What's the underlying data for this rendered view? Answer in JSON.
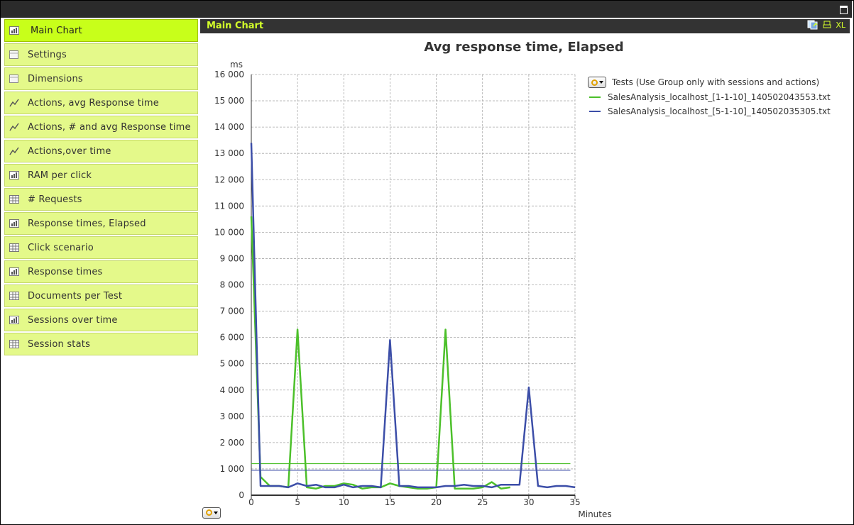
{
  "sidebar": {
    "items": [
      {
        "label": "Main Chart",
        "icon": "bar-chart-icon",
        "active": true
      },
      {
        "label": "Settings",
        "icon": "grid-icon",
        "active": false
      },
      {
        "label": "Dimensions",
        "icon": "grid-icon",
        "active": false
      },
      {
        "label": "Actions, avg Response time",
        "icon": "line-chart-icon",
        "active": false
      },
      {
        "label": "Actions, # and avg Response time",
        "icon": "line-chart-icon",
        "active": false
      },
      {
        "label": "Actions,over time",
        "icon": "line-chart-icon",
        "active": false
      },
      {
        "label": "RAM per click",
        "icon": "bar-chart-icon",
        "active": false
      },
      {
        "label": "# Requests",
        "icon": "table-icon",
        "active": false
      },
      {
        "label": "Response times, Elapsed",
        "icon": "bar-chart-icon",
        "active": false
      },
      {
        "label": "Click scenario",
        "icon": "table-icon",
        "active": false
      },
      {
        "label": "Response times",
        "icon": "bar-chart-icon",
        "active": false
      },
      {
        "label": "Documents per Test",
        "icon": "table-icon",
        "active": false
      },
      {
        "label": "Sessions over time",
        "icon": "bar-chart-icon",
        "active": false
      },
      {
        "label": "Session stats",
        "icon": "table-icon",
        "active": false
      }
    ]
  },
  "panel": {
    "title": "Main Chart",
    "xl_label": "XL"
  },
  "legend": {
    "title": "Tests (Use Group only with sessions and actions)"
  },
  "colors": {
    "accent": "#c8ff1a",
    "nav_bg": "#e4f98a",
    "series_green": "#4cc02a",
    "series_blue": "#3c4ea8"
  },
  "chart_data": {
    "type": "line",
    "title": "Avg response time, Elapsed",
    "ylabel": "ms",
    "xlabel": "Minutes",
    "xlim": [
      0,
      35
    ],
    "ylim": [
      0,
      16000
    ],
    "xticks": [
      0,
      5,
      10,
      15,
      20,
      25,
      30,
      35
    ],
    "yticks": [
      0,
      1000,
      2000,
      3000,
      4000,
      5000,
      6000,
      7000,
      8000,
      9000,
      10000,
      11000,
      12000,
      13000,
      14000,
      15000,
      16000
    ],
    "ytick_labels": [
      "0",
      "1 000",
      "2 000",
      "3 000",
      "4 000",
      "5 000",
      "6 000",
      "7 000",
      "8 000",
      "9 000",
      "10 000",
      "11 000",
      "12 000",
      "13 000",
      "14 000",
      "15 000",
      "16 000"
    ],
    "grid": true,
    "legend": "right",
    "series": [
      {
        "name": "SalesAnalysis_localhost_[1-1-10]_140502043553.txt",
        "color": "#4cc02a",
        "average": 1200,
        "points": [
          [
            0,
            10600
          ],
          [
            1,
            700
          ],
          [
            2,
            350
          ],
          [
            3,
            350
          ],
          [
            4,
            300
          ],
          [
            5,
            6300
          ],
          [
            6,
            300
          ],
          [
            7,
            250
          ],
          [
            8,
            350
          ],
          [
            9,
            350
          ],
          [
            10,
            450
          ],
          [
            11,
            400
          ],
          [
            12,
            250
          ],
          [
            13,
            300
          ],
          [
            14,
            300
          ],
          [
            15,
            450
          ],
          [
            16,
            350
          ],
          [
            17,
            300
          ],
          [
            18,
            250
          ],
          [
            19,
            250
          ],
          [
            20,
            300
          ],
          [
            21,
            6300
          ],
          [
            22,
            250
          ],
          [
            23,
            250
          ],
          [
            24,
            250
          ],
          [
            25,
            300
          ],
          [
            26,
            500
          ],
          [
            27,
            250
          ],
          [
            28,
            300
          ]
        ]
      },
      {
        "name": "SalesAnalysis_localhost_[5-1-10]_140502035305.txt",
        "color": "#3c4ea8",
        "average": 950,
        "points": [
          [
            0,
            13400
          ],
          [
            1,
            350
          ],
          [
            2,
            350
          ],
          [
            3,
            350
          ],
          [
            4,
            300
          ],
          [
            5,
            450
          ],
          [
            6,
            350
          ],
          [
            7,
            400
          ],
          [
            8,
            300
          ],
          [
            9,
            300
          ],
          [
            10,
            400
          ],
          [
            11,
            300
          ],
          [
            12,
            350
          ],
          [
            13,
            350
          ],
          [
            14,
            300
          ],
          [
            15,
            5900
          ],
          [
            16,
            350
          ],
          [
            17,
            350
          ],
          [
            18,
            300
          ],
          [
            19,
            300
          ],
          [
            20,
            300
          ],
          [
            21,
            350
          ],
          [
            22,
            350
          ],
          [
            23,
            400
          ],
          [
            24,
            350
          ],
          [
            25,
            350
          ],
          [
            26,
            300
          ],
          [
            27,
            400
          ],
          [
            28,
            400
          ],
          [
            29,
            400
          ],
          [
            30,
            4100
          ],
          [
            31,
            350
          ],
          [
            32,
            300
          ],
          [
            33,
            350
          ],
          [
            34,
            350
          ],
          [
            35,
            300
          ]
        ]
      }
    ]
  }
}
